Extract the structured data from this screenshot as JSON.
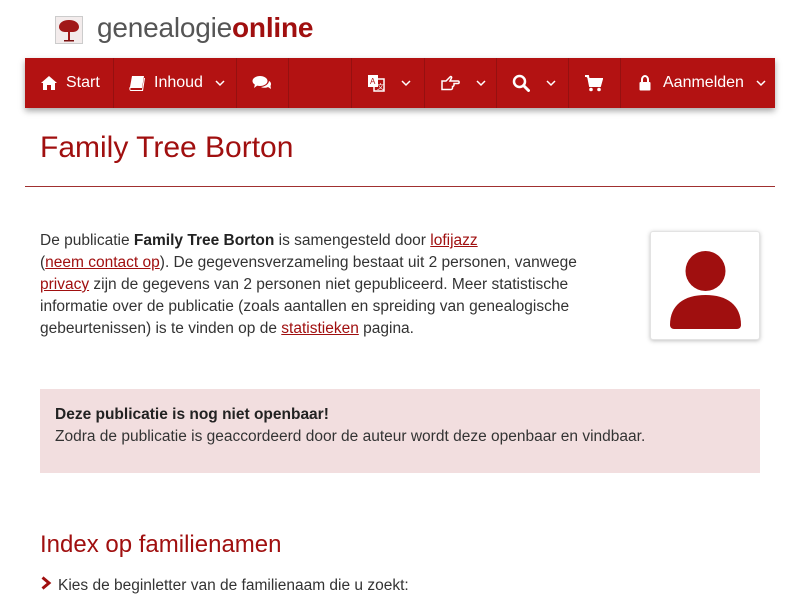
{
  "logo": {
    "part1": "genealogie",
    "part2": "online"
  },
  "nav": {
    "start": "Start",
    "inhoud": "Inhoud",
    "aanmelden": "Aanmelden"
  },
  "page": {
    "title": "Family Tree Borton"
  },
  "intro": {
    "t1": "De publicatie ",
    "pub_name": "Family Tree Borton",
    "t2": " is samengesteld door ",
    "author_link": "lofijazz",
    "t3": "(",
    "contact_link": "neem contact op",
    "t4": "). De gegevensverzameling bestaat uit 2 personen, vanwege ",
    "privacy_link": "privacy",
    "t5": " zijn de gegevens van 2 personen niet gepubliceerd. Meer statistische informatie over de publicatie (zoals aantallen en spreiding van genealogische gebeurtenissen) is te vinden op de ",
    "stats_link": "statistieken",
    "t6": " pagina."
  },
  "alert": {
    "title": "Deze publicatie is nog niet openbaar!",
    "body": "Zodra de publicatie is geaccordeerd door de auteur wordt deze openbaar en vindbaar."
  },
  "index": {
    "title": "Index op familienamen",
    "hint": "Kies de beginletter van de familienaam die u zoekt:"
  },
  "colors": {
    "brand": "#b31212",
    "accent_text": "#a00f0f",
    "alert_bg": "#f2dedf"
  },
  "icons": {
    "start": "home-icon",
    "inhoud": "book-icon",
    "forum": "comments-icon",
    "language": "translate-icon",
    "share": "hand-point-right-icon",
    "search": "search-icon",
    "cart": "shopping-cart-icon",
    "login": "lock-icon",
    "avatar": "user-silhouette-icon",
    "hint": "chevron-right-icon"
  }
}
